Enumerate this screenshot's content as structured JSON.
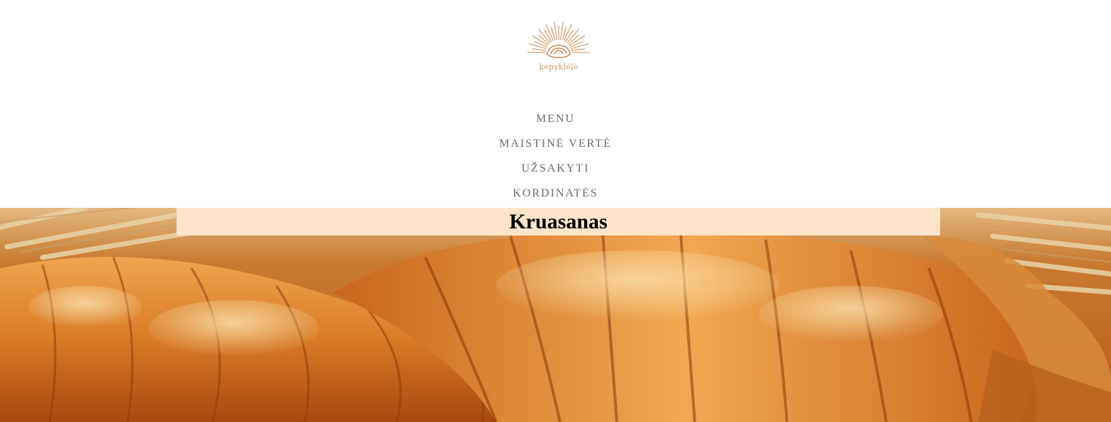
{
  "brand": {
    "name": "kepyklėlė",
    "logo_icon": "croissant-sunburst-icon",
    "accent_color": "#d0986a"
  },
  "nav": {
    "items": [
      {
        "label": "MENU"
      },
      {
        "label": "MAISTINĖ VERTĖ"
      },
      {
        "label": "UŽSAKYTI"
      },
      {
        "label": "KORDINATĖS"
      }
    ]
  },
  "hero": {
    "title": "Kruasanas",
    "title_background": "#fde4c8",
    "image": "croissants-photo"
  }
}
